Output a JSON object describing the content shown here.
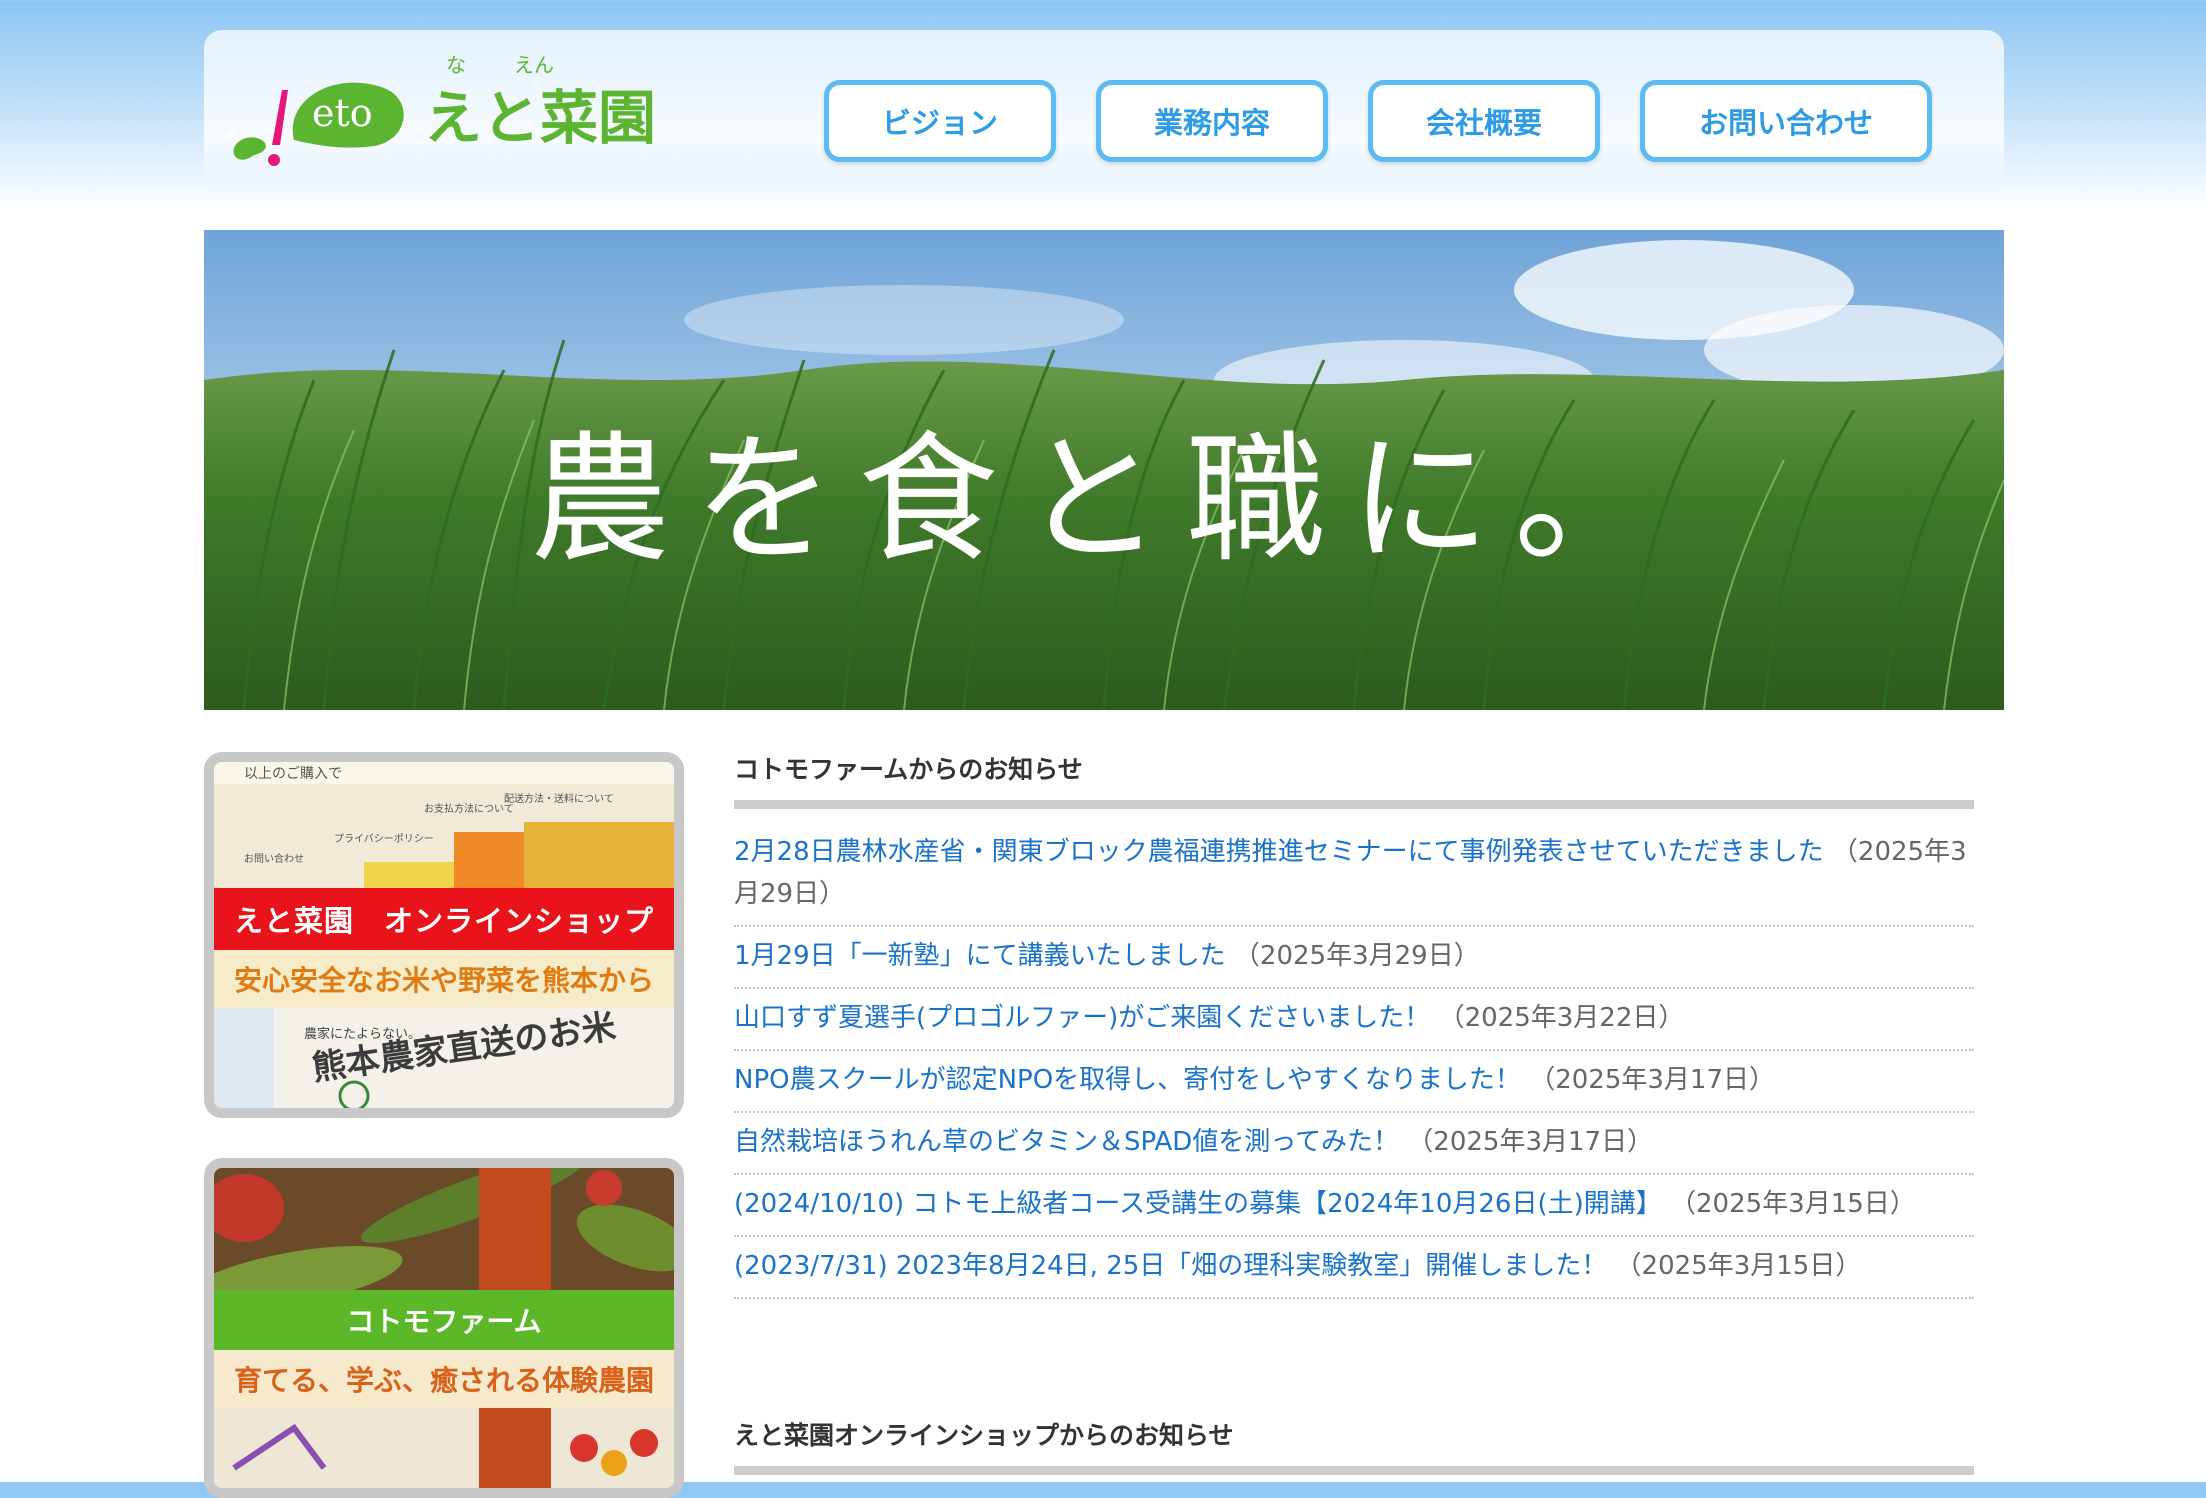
{
  "header": {
    "logo_small": "eto",
    "logo_name": "えと菜園",
    "logo_ruby_1": "な",
    "logo_ruby_2": "えん",
    "nav": [
      "ビジョン",
      "業務内容",
      "会社概要",
      "お問い合わせ"
    ]
  },
  "hero": {
    "catchphrase": "農を食と職に。"
  },
  "banners": {
    "shop": {
      "ribbon": "えと菜園　オンラインショップ",
      "tagline": "安心安全なお米や野菜を熊本から",
      "photo_text_1": "熊本農家直送のお米",
      "photo_text_2": "以上のご購入で",
      "photo_text_3": "お問い合わせ",
      "photo_text_4": "プライバシーポリシー",
      "photo_text_5": "お支払方法について",
      "photo_text_6": "配送方法・送料について",
      "photo_text_7": "農家にたよらない。"
    },
    "farm": {
      "ribbon": "コトモファーム",
      "tagline": "育てる、学ぶ、癒される体験農園"
    }
  },
  "news": {
    "title": "コトモファームからのお知らせ",
    "items": [
      {
        "text": "2月28日農林水産省・関東ブロック農福連携推進セミナーにて事例発表させていただきました",
        "date": "（2025年3月29日）"
      },
      {
        "text": "1月29日「一新塾」にて講義いたしました",
        "date": "（2025年3月29日）"
      },
      {
        "text": "山口すず夏選手(プロゴルファー)がご来園くださいました！",
        "date": "（2025年3月22日）"
      },
      {
        "text": "NPO農スクールが認定NPOを取得し、寄付をしやすくなりました！",
        "date": "（2025年3月17日）"
      },
      {
        "text": "自然栽培ほうれん草のビタミン＆SPAD値を測ってみた！",
        "date": "（2025年3月17日）"
      },
      {
        "text": "(2024/10/10) コトモ上級者コース受講生の募集【2024年10月26日(土)開講】",
        "date": "（2025年3月15日）"
      },
      {
        "text": "(2023/7/31) 2023年8月24日, 25日「畑の理科実験教室」開催しました！",
        "date": "（2025年3月15日）"
      }
    ]
  },
  "news2": {
    "title": "えと菜園オンラインショップからのお知らせ"
  },
  "colors": {
    "nav_border": "#5bbcf2",
    "nav_text": "#2d9be6",
    "link": "#1a73c9",
    "logo_green": "#5cb531",
    "logo_pink": "#e4177a"
  }
}
